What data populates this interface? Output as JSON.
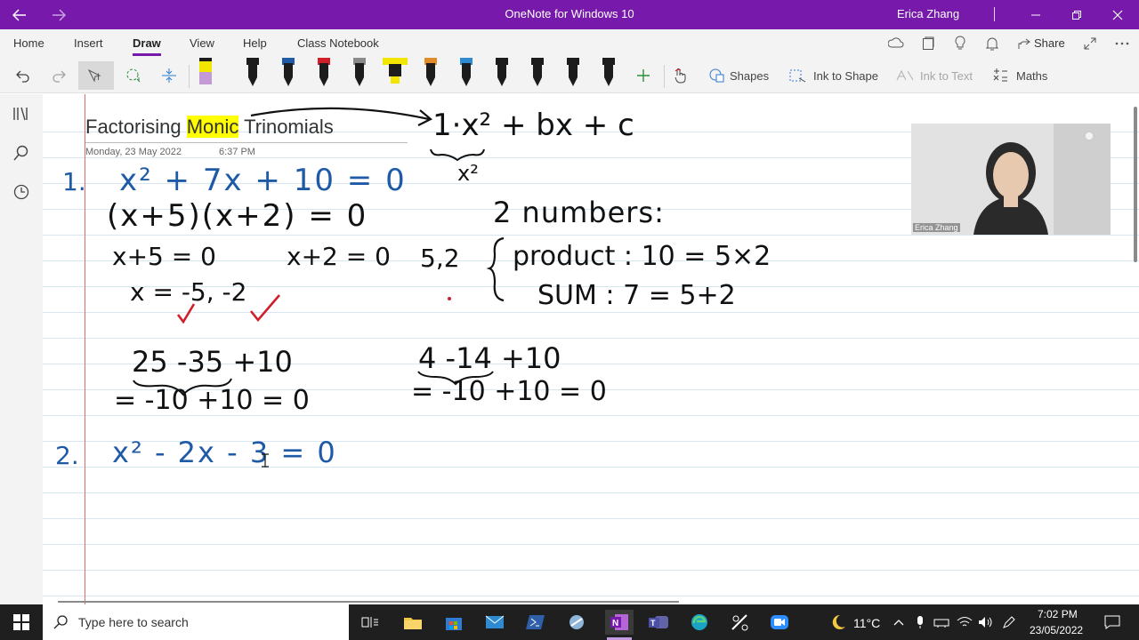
{
  "window": {
    "title": "OneNote for Windows 10",
    "user": "Erica Zhang"
  },
  "menu": {
    "tabs": [
      "Home",
      "Insert",
      "Draw",
      "View",
      "Help",
      "Class Notebook"
    ],
    "active": "Draw",
    "share_label": "Share"
  },
  "toolbar": {
    "shapes_label": "Shapes",
    "ink_to_shape_label": "Ink to Shape",
    "ink_to_text_label": "Ink to Text",
    "maths_label": "Maths",
    "pen_colors": [
      "#1c1c1c",
      "#1c1c1c",
      "#1f5aa6",
      "#d11f2a",
      "#8a8a8a",
      "#f2e600",
      "#e08a2a",
      "#2e8bd1",
      "#1c1c1c",
      "#1c1c1c",
      "#1c1c1c",
      "#1c1c1c"
    ]
  },
  "page": {
    "title_before": "Factorising ",
    "title_highlight": "Monic",
    "title_after": " Trinomials",
    "date": "Monday, 23 May 2022",
    "time": "6:37 PM"
  },
  "ink": {
    "general_form": "1·x² + bx + c",
    "general_form_note": "x²",
    "q1_number": "1.",
    "q1_equation": "x² + 7x + 10 = 0",
    "q1_factored": "(x+5)(x+2) = 0",
    "q1_root_eq_a": "x+5 = 0",
    "q1_root_eq_b": "x+2 = 0",
    "q1_solutions": "x = -5, -2",
    "numbers_heading": "2 numbers:",
    "pair": "5,2",
    "product_line": "product : 10 = 5×2",
    "sum_line": "SUM : 7 = 5+2",
    "check_a_line1": "25 -35 +10",
    "check_a_line2": "= -10 +10 = 0",
    "check_b_line1": "4 -14 +10",
    "check_b_line2": "= -10 +10 = 0",
    "q2_number": "2.",
    "q2_equation": "x² - 2x - 3 = 0"
  },
  "webcam": {
    "label": "Erica Zhang"
  },
  "taskbar": {
    "search_placeholder": "Type here to search",
    "temperature": "11°C",
    "time": "7:02 PM",
    "date": "23/05/2022"
  },
  "colors": {
    "accent": "#7719aa",
    "ink_blue": "#1f5aa6",
    "ink_black": "#111111",
    "ink_red": "#d11f2a"
  }
}
